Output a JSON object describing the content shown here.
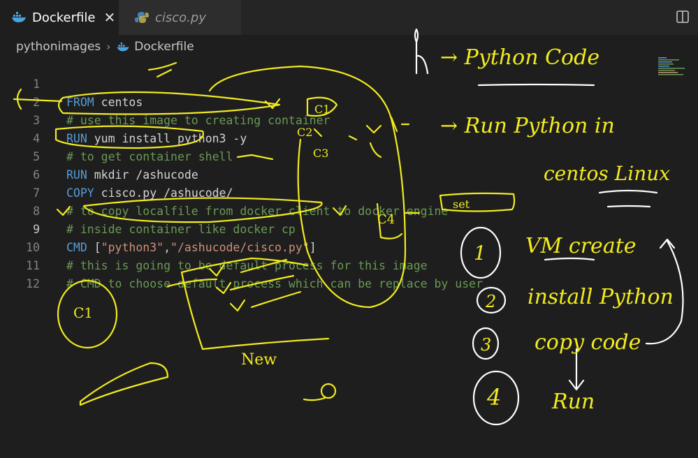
{
  "tabs": [
    {
      "label": "Dockerfile",
      "active": true,
      "icon": "docker-icon"
    },
    {
      "label": "cisco.py",
      "active": false,
      "icon": "python-icon"
    }
  ],
  "breadcrumb": {
    "folder": "pythonimages",
    "file": "Dockerfile"
  },
  "editor": {
    "current_line": 9,
    "lines": [
      {
        "n": "1",
        "kw": "FROM",
        "text": " centos"
      },
      {
        "n": "2",
        "comment": "# use this image to creating container"
      },
      {
        "n": "3",
        "kw": "RUN",
        "text": " yum install python3 -y"
      },
      {
        "n": "4",
        "comment": "# to get container shell"
      },
      {
        "n": "5",
        "kw": "RUN",
        "text": " mkdir /ashucode"
      },
      {
        "n": "6",
        "kw": "COPY",
        "text": " cisco.py /ashucode/"
      },
      {
        "n": "7",
        "comment": "# to copy localfile from docker client to docker engine"
      },
      {
        "n": "8",
        "comment": "# inside container like docker cp"
      },
      {
        "n": "9",
        "kw": "CMD",
        "text": " [",
        "str1": "\"python3\"",
        "text2": ",",
        "str2": "\"/ashucode/cisco.py\"",
        "text3": "]"
      },
      {
        "n": "10",
        "comment": "# this is going to be default process for this image"
      },
      {
        "n": "11",
        "comment": "# CMD to choose default process which can be replace by user"
      },
      {
        "n": "12"
      }
    ]
  },
  "handwritten": {
    "top_note": "→ Python Code",
    "run_note": "→ Run Python in",
    "centos_note": "centos Linux",
    "step1_num": "1",
    "step1": "VM create",
    "step2_num": "2",
    "step2": "install Python",
    "step3_num": "3",
    "step3": "copy code",
    "step4_num": "4",
    "step4": "Run",
    "set_label": "set",
    "c1_label": "C1",
    "c1b_label": "C1",
    "c2_label": "C2",
    "c3_label": "C3",
    "c4_label": "C4",
    "new_label": "New"
  },
  "colors": {
    "annotation": "#f2ec1e",
    "keyword": "#569cd6",
    "comment": "#6a9955",
    "string": "#ce9178"
  }
}
